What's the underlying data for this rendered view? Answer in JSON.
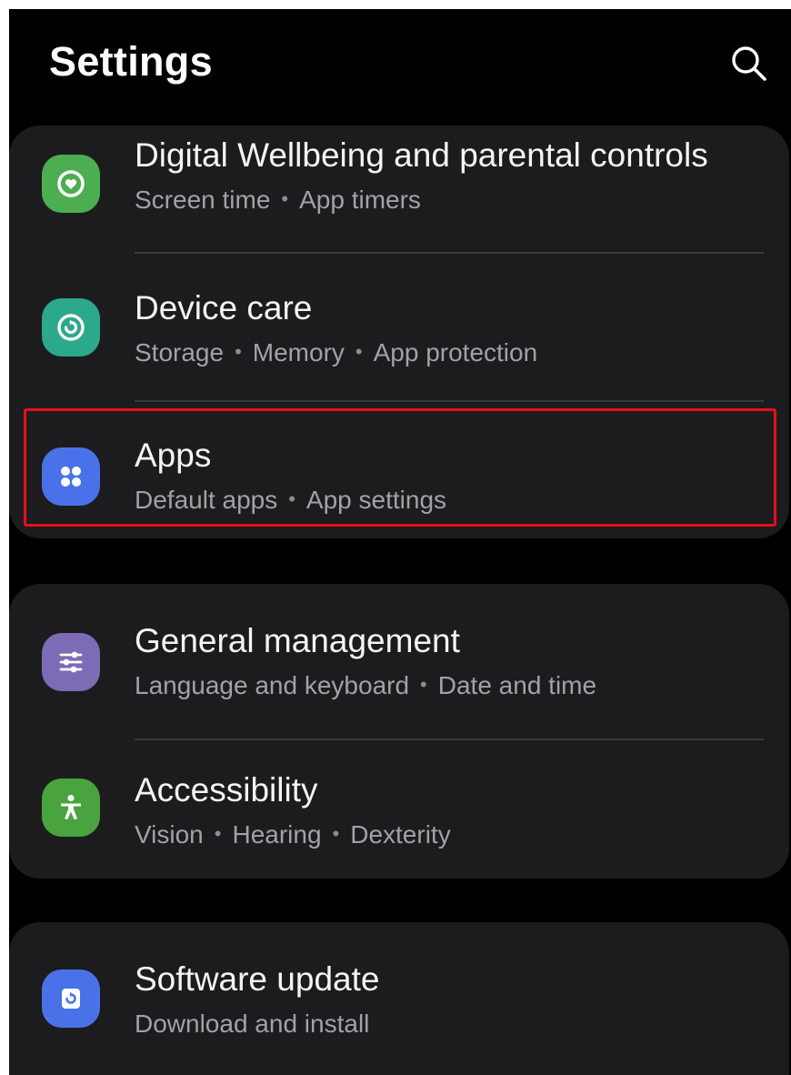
{
  "header": {
    "title": "Settings",
    "search_icon": "search-icon"
  },
  "colors": {
    "highlight": "#e3101c",
    "digital_wellbeing": "#4cae50",
    "device_care": "#2ba98a",
    "apps": "#4a72e8",
    "general_management": "#7d6bb5",
    "accessibility": "#49a33f",
    "software_update": "#4a72e8"
  },
  "groups": [
    {
      "items": [
        {
          "title": "Digital Wellbeing and parental controls",
          "subtitle": [
            "Screen time",
            "App timers"
          ],
          "icon": "digital-wellbeing-icon"
        },
        {
          "title": "Device care",
          "subtitle": [
            "Storage",
            "Memory",
            "App protection"
          ],
          "icon": "device-care-icon"
        },
        {
          "title": "Apps",
          "subtitle": [
            "Default apps",
            "App settings"
          ],
          "icon": "apps-icon",
          "highlighted": true
        }
      ]
    },
    {
      "items": [
        {
          "title": "General management",
          "subtitle": [
            "Language and keyboard",
            "Date and time"
          ],
          "icon": "general-management-icon"
        },
        {
          "title": "Accessibility",
          "subtitle": [
            "Vision",
            "Hearing",
            "Dexterity"
          ],
          "icon": "accessibility-icon"
        }
      ]
    },
    {
      "items": [
        {
          "title": "Software update",
          "subtitle": [
            "Download and install"
          ],
          "icon": "software-update-icon"
        }
      ]
    }
  ]
}
